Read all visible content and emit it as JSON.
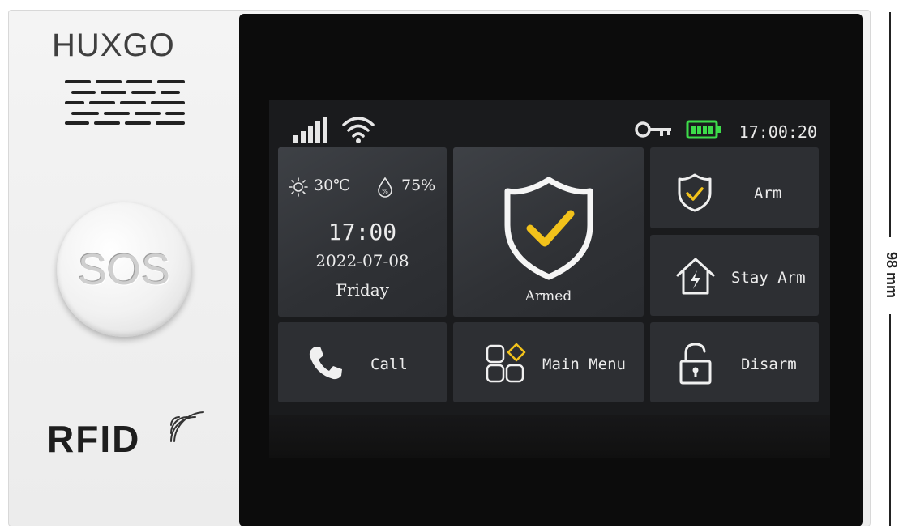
{
  "device": {
    "brand": "HUXGO",
    "sos_label": "SOS",
    "rfid_label": "RFID",
    "dimension_label": "98 mm"
  },
  "status": {
    "time": "17:00:20",
    "icons": [
      "signal-icon",
      "wifi-icon",
      "key-icon",
      "battery-icon"
    ],
    "battery_color": "#3ddc4a"
  },
  "weather_tile": {
    "temperature": "30℃",
    "humidity": "75%",
    "time": "17:00",
    "date": "2022-07-08",
    "weekday": "Friday"
  },
  "armed_tile": {
    "label": "Armed",
    "accent": "#f2c21b"
  },
  "buttons": {
    "arm": "Arm",
    "stay_arm": "Stay Arm",
    "call": "Call",
    "main_menu": "Main Menu",
    "disarm": "Disarm"
  }
}
